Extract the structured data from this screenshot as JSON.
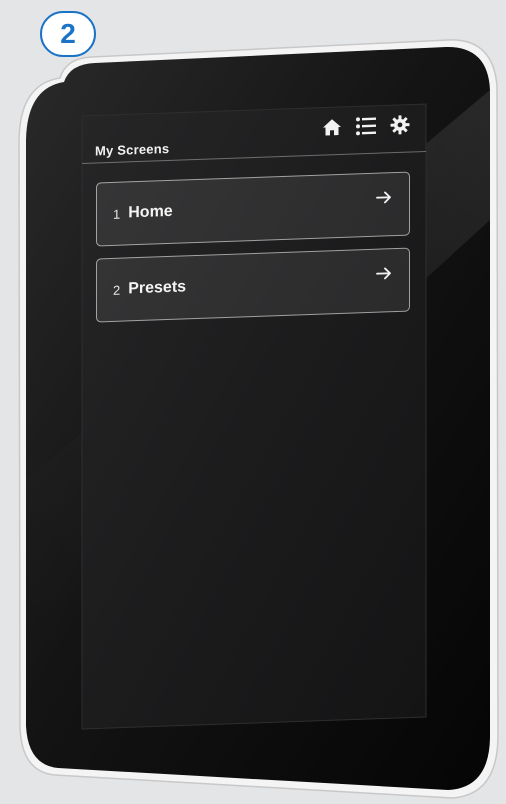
{
  "step": {
    "number": "2",
    "color": "#1a73c6"
  },
  "screen": {
    "title": "My Screens",
    "icons": [
      "home-icon",
      "list-icon",
      "gear-icon"
    ],
    "items": [
      {
        "number": "1",
        "label": "Home",
        "icon": "arrow-right-icon"
      },
      {
        "number": "2",
        "label": "Presets",
        "icon": "arrow-right-icon"
      }
    ]
  },
  "colors": {
    "background": "#e4e5e7",
    "device_body": "#111111",
    "device_frame": "#f2f2f2",
    "screen": "#1b1b1c",
    "text": "#f2f2f2"
  }
}
